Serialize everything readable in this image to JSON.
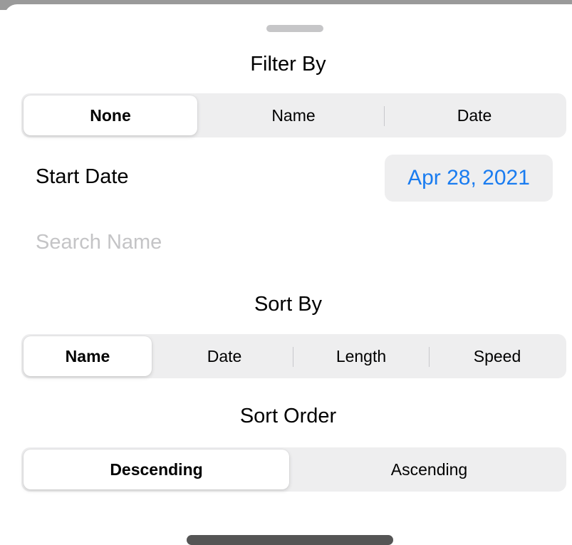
{
  "filter": {
    "title": "Filter By",
    "options": [
      "None",
      "Name",
      "Date"
    ],
    "selected": "None"
  },
  "start_date": {
    "label": "Start Date",
    "value": "Apr 28, 2021"
  },
  "search": {
    "placeholder": "Search Name",
    "value": ""
  },
  "sort_by": {
    "title": "Sort By",
    "options": [
      "Name",
      "Date",
      "Length",
      "Speed"
    ],
    "selected": "Name"
  },
  "sort_order": {
    "title": "Sort Order",
    "options": [
      "Descending",
      "Ascending"
    ],
    "selected": "Descending"
  },
  "colors": {
    "accent": "#1a7cf0",
    "segment_bg": "#eeeeef",
    "placeholder": "#c4c4c6"
  }
}
